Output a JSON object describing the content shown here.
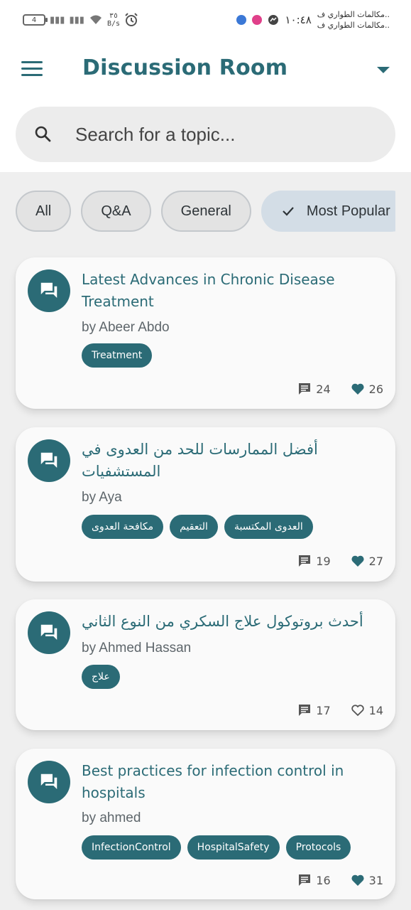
{
  "status_bar": {
    "battery": "4",
    "speed_value": "٣٥",
    "speed_unit": "B/s",
    "time": "١٠:٤٨",
    "notification_line1": "مكالمات الطواري ف..",
    "notification_line2": "مكالمات الطواري ف.."
  },
  "header": {
    "title": "Discussion Room"
  },
  "search": {
    "placeholder": "Search for a topic..."
  },
  "filters": [
    {
      "label": "All",
      "selected": false
    },
    {
      "label": "Q&A",
      "selected": false
    },
    {
      "label": "General",
      "selected": false
    },
    {
      "label": "Most Popular",
      "selected": true
    }
  ],
  "posts": [
    {
      "title": "Latest Advances in Chronic Disease Treatment",
      "author": "by Abeer Abdo",
      "tags": [
        "Treatment"
      ],
      "comments": "24",
      "likes": "26",
      "liked": true
    },
    {
      "title": "أفضل الممارسات للحد من العدوى في المستشفيات",
      "author": "by Aya",
      "tags": [
        "مكافحة العدوى",
        "التعقيم",
        "العدوى المكتسبة"
      ],
      "comments": "19",
      "likes": "27",
      "liked": true
    },
    {
      "title": "أحدث بروتوكول علاج السكري من النوع الثاني",
      "author": "by Ahmed Hassan",
      "tags": [
        "علاج"
      ],
      "comments": "17",
      "likes": "14",
      "liked": false
    },
    {
      "title": "Best practices for infection control in hospitals",
      "author": "by ahmed",
      "tags": [
        "InfectionControl",
        "HospitalSafety",
        "Protocols"
      ],
      "comments": "16",
      "likes": "31",
      "liked": true
    }
  ],
  "colors": {
    "primary": "#2b6b76",
    "chip_selected": "#d3dde6",
    "background": "#efefef"
  }
}
